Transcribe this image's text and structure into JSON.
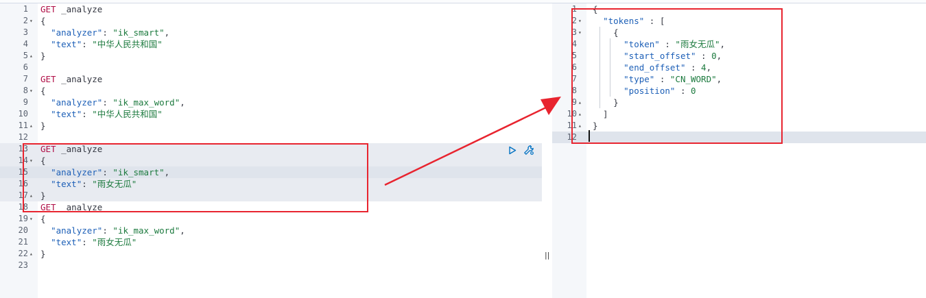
{
  "left_editor": {
    "lines": [
      {
        "n": "1",
        "fold": "",
        "html": "<span class=\"m\">GET</span> _analyze"
      },
      {
        "n": "2",
        "fold": "▾",
        "html": "{"
      },
      {
        "n": "3",
        "fold": "",
        "html": "  <span class=\"k\">\"analyzer\"</span>: <span class=\"s\">\"ik_smart\"</span>,"
      },
      {
        "n": "4",
        "fold": "",
        "html": "  <span class=\"k\">\"text\"</span>: <span class=\"s\">\"中华人民共和国\"</span>"
      },
      {
        "n": "5",
        "fold": "▴",
        "html": "}"
      },
      {
        "n": "6",
        "fold": "",
        "html": ""
      },
      {
        "n": "7",
        "fold": "",
        "html": "<span class=\"m\">GET</span> _analyze"
      },
      {
        "n": "8",
        "fold": "▾",
        "html": "{"
      },
      {
        "n": "9",
        "fold": "",
        "html": "  <span class=\"k\">\"analyzer\"</span>: <span class=\"s\">\"ik_max_word\"</span>,"
      },
      {
        "n": "10",
        "fold": "",
        "html": "  <span class=\"k\">\"text\"</span>: <span class=\"s\">\"中华人民共和国\"</span>"
      },
      {
        "n": "11",
        "fold": "▴",
        "html": "}"
      },
      {
        "n": "12",
        "fold": "",
        "html": ""
      },
      {
        "n": "13",
        "fold": "",
        "html": "<span class=\"m\">GET</span> _analyze",
        "cls": "hl"
      },
      {
        "n": "14",
        "fold": "▾",
        "html": "{",
        "cls": "hl"
      },
      {
        "n": "15",
        "fold": "",
        "html": "  <span class=\"k\">\"analyzer\"</span>: <span class=\"s\">\"ik_smart\"</span>,",
        "cls": "cur"
      },
      {
        "n": "16",
        "fold": "",
        "html": "  <span class=\"k\">\"text\"</span>: <span class=\"s\">\"雨女无瓜\"</span>",
        "cls": "hl"
      },
      {
        "n": "17",
        "fold": "▴",
        "html": "}",
        "cls": "hl"
      },
      {
        "n": "18",
        "fold": "",
        "html": "<span class=\"m\">GET</span> _analyze"
      },
      {
        "n": "19",
        "fold": "▾",
        "html": "{"
      },
      {
        "n": "20",
        "fold": "",
        "html": "  <span class=\"k\">\"analyzer\"</span>: <span class=\"s\">\"ik_max_word\"</span>,"
      },
      {
        "n": "21",
        "fold": "",
        "html": "  <span class=\"k\">\"text\"</span>: <span class=\"s\">\"雨女无瓜\"</span>"
      },
      {
        "n": "22",
        "fold": "▴",
        "html": "}"
      },
      {
        "n": "23",
        "fold": "",
        "html": ""
      }
    ]
  },
  "right_editor": {
    "lines": [
      {
        "n": "1",
        "fold": "",
        "html": "{"
      },
      {
        "n": "2",
        "fold": "▾",
        "html": "  <span class=\"k\">\"tokens\"</span> : ["
      },
      {
        "n": "3",
        "fold": "▾",
        "html": "    {"
      },
      {
        "n": "4",
        "fold": "",
        "html": "      <span class=\"k\">\"token\"</span> : <span class=\"s\">\"雨女无瓜\"</span>,"
      },
      {
        "n": "5",
        "fold": "",
        "html": "      <span class=\"k\">\"start_offset\"</span> : <span class=\"n\">0</span>,"
      },
      {
        "n": "6",
        "fold": "",
        "html": "      <span class=\"k\">\"end_offset\"</span> : <span class=\"n\">4</span>,"
      },
      {
        "n": "7",
        "fold": "",
        "html": "      <span class=\"k\">\"type\"</span> : <span class=\"s\">\"CN_WORD\"</span>,"
      },
      {
        "n": "8",
        "fold": "",
        "html": "      <span class=\"k\">\"position\"</span> : <span class=\"n\">0</span>"
      },
      {
        "n": "9",
        "fold": "▴",
        "html": "    }"
      },
      {
        "n": "10",
        "fold": "▴",
        "html": "  ]"
      },
      {
        "n": "11",
        "fold": "▴",
        "html": "}"
      },
      {
        "n": "12",
        "fold": "",
        "html": "",
        "cls": "cur"
      }
    ]
  },
  "actions": {
    "play_icon": "play-icon",
    "wrench_icon": "wrench-icon"
  },
  "resizer_glyph": "||",
  "colors": {
    "annotation": "#e8242f",
    "method": "#b00f47",
    "key": "#1c5fb7",
    "string": "#1c7a3e"
  }
}
